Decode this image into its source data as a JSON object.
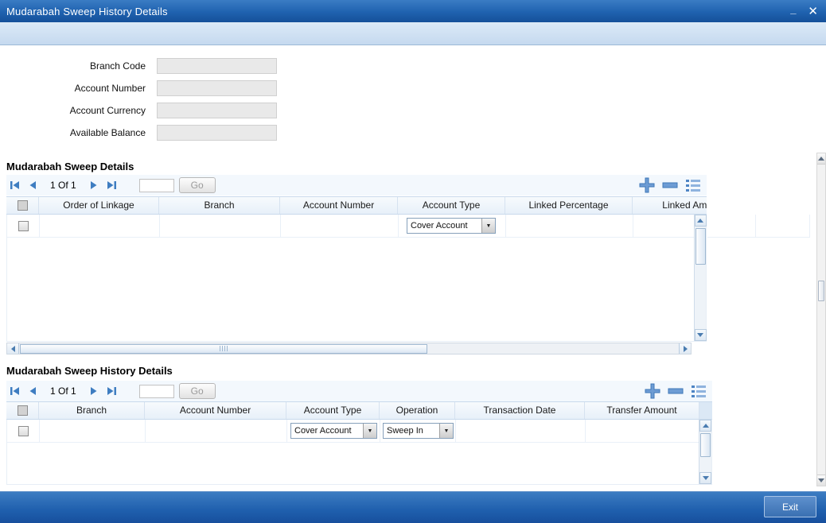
{
  "window": {
    "title": "Mudarabah Sweep History Details",
    "minimize_glyph": "_",
    "close_glyph": "✕"
  },
  "icons": {
    "dropdown_arrow": "▼"
  },
  "form": {
    "fields": [
      {
        "label": "Branch Code",
        "value": ""
      },
      {
        "label": "Account Number",
        "value": ""
      },
      {
        "label": "Account Currency",
        "value": ""
      },
      {
        "label": "Available Balance",
        "value": ""
      }
    ]
  },
  "sweep_details": {
    "heading": "Mudarabah Sweep Details",
    "pagination": {
      "page_text": "1 Of 1",
      "goto_value": "",
      "go_label": "Go"
    },
    "columns": [
      "Order of Linkage",
      "Branch",
      "Account Number",
      "Account Type",
      "Linked Percentage",
      "Linked Amount"
    ],
    "rows": [
      {
        "order_of_linkage": "",
        "branch": "",
        "account_number": "",
        "account_type": "Cover Account",
        "linked_percentage": "",
        "linked_amount": ""
      }
    ]
  },
  "history": {
    "heading": "Mudarabah Sweep History Details",
    "pagination": {
      "page_text": "1 Of 1",
      "goto_value": "",
      "go_label": "Go"
    },
    "columns": [
      "Branch",
      "Account Number",
      "Account Type",
      "Operation",
      "Transaction Date",
      "Transfer Amount"
    ],
    "rows": [
      {
        "branch": "",
        "account_number": "",
        "account_type": "Cover Account",
        "operation": "Sweep In",
        "transaction_date": "",
        "transfer_amount": ""
      }
    ]
  },
  "footer": {
    "exit_label": "Exit"
  },
  "colors": {
    "titlebar_blue": "#1f62af",
    "accent_blue": "#3e7dc1",
    "footer_blue": "#1f5fad",
    "header_fill": "#e7f0f9",
    "field_gray": "#e9e9e9"
  }
}
